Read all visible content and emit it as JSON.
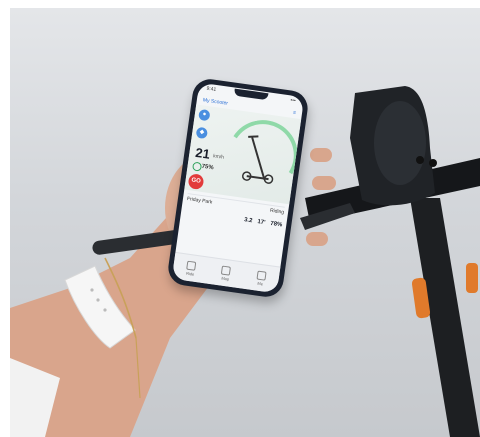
{
  "screen": {
    "status": {
      "time": "9:41",
      "network": "•••"
    },
    "header": {
      "title": "My Scooter",
      "action": "≡"
    },
    "speed": {
      "value": "21",
      "unit": "km/h"
    },
    "battery": {
      "value": "75%"
    },
    "go_label": "GO",
    "route": {
      "label": "Friday Park",
      "status": "Riding"
    },
    "stats": [
      {
        "value": "3.2"
      },
      {
        "value": "17'"
      },
      {
        "value": "78%"
      }
    ],
    "tabs": [
      {
        "label": "Ride"
      },
      {
        "label": "Map"
      },
      {
        "label": "Me"
      }
    ]
  },
  "colors": {
    "accent": "#4a8fe0",
    "go": "#e23b3b",
    "ring": "#8fd9a8",
    "phone": "#1b2230",
    "scooter": "#1d1f22",
    "reflector": "#e07a2b"
  }
}
